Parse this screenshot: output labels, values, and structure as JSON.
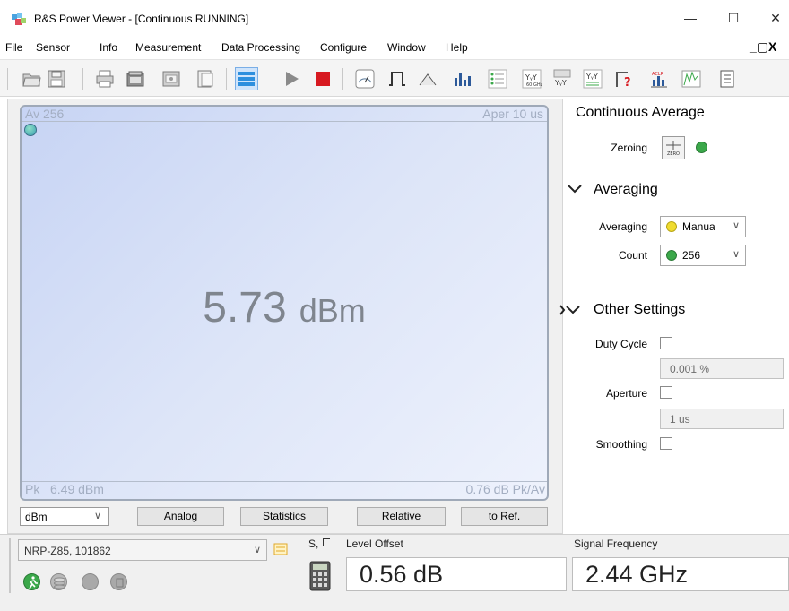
{
  "window": {
    "title": "R&S Power Viewer - [Continuous  RUNNING]",
    "minimize_glyph": "—",
    "maximize_glyph": "☐",
    "close_glyph": "✕",
    "mdi_controls": "_▢X"
  },
  "menu": {
    "items": [
      "File",
      "Sensor",
      "Info",
      "Measurement",
      "Data Processing",
      "Configure",
      "Window",
      "Help"
    ]
  },
  "toolbar": {
    "icons": [
      "open-file-icon",
      "save-icon",
      "print-icon",
      "camera-icon",
      "screenshot-icon",
      "export-icon",
      "list-view-icon",
      "play-icon",
      "stop-icon",
      "meter-icon",
      "pulse-icon",
      "trace-icon",
      "bar-chart-icon",
      "frequency-table-icon",
      "yy-icon",
      "yy-multi-icon",
      "yy-list-icon",
      "question-icon",
      "aclr-icon",
      "spectrum-icon",
      "report-icon"
    ],
    "labels": {
      "aclr": "ACLR",
      "freq": "60 GHz"
    }
  },
  "display": {
    "top_left": "Av 256",
    "top_right": "Aper 10 us",
    "main_value": "5.73",
    "main_unit": "dBm",
    "bottom_left": "Pk   6.49 dBm",
    "bottom_right": "0.76 dB Pk/Av"
  },
  "controls": {
    "unit": "dBm",
    "buttons": [
      "Analog",
      "Statistics",
      "Relative",
      "to Ref."
    ]
  },
  "settings": {
    "title": "Continuous Average",
    "zeroing_label": "Zeroing",
    "zero_icon_text": "ZERO",
    "averaging_section": "Averaging",
    "averaging_label": "Averaging",
    "averaging_value": "Manua",
    "count_label": "Count",
    "count_value": "256",
    "other_section": "Other Settings",
    "duty_cycle_label": "Duty Cycle",
    "duty_cycle_value": "0.001 %",
    "aperture_label": "Aperture",
    "aperture_value": "1 us",
    "smoothing_label": "Smoothing"
  },
  "status": {
    "sensor": "NRP-Z85, 101862",
    "s_label": "S,",
    "level_offset_label": "Level Offset",
    "level_offset_value": "0.56 dB",
    "signal_frequency_label": "Signal Frequency",
    "signal_frequency_value": "2.44 GHz"
  },
  "colors": {
    "display_border": "#9fa9b8",
    "display_text": "#7f858e",
    "status_green": "#3ba84a",
    "status_yellow": "#f0dc30",
    "stop_red": "#d71920"
  }
}
